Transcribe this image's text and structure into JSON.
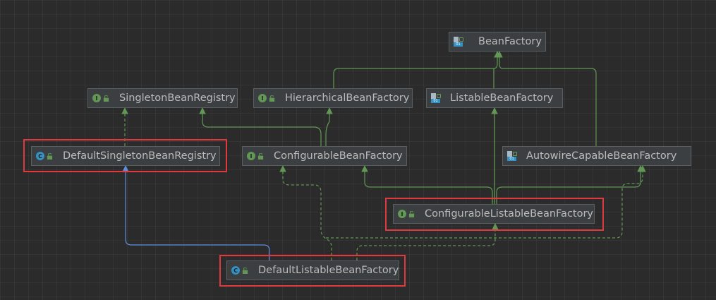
{
  "colors": {
    "background": "#2b2b2b",
    "node_fill": "#3c3f41",
    "node_border": "#5b5e60",
    "text": "#bbbbbb",
    "extends_edge": "#629755",
    "implements_edge": "#629755",
    "class_extends_edge": "#5c8ee0",
    "highlight": "#e0393e"
  },
  "nodes": {
    "bean_factory": {
      "label": "BeanFactory",
      "kind": "interface-library",
      "icon": "library-interface-icon"
    },
    "singleton_bean_registry": {
      "label": "SingletonBeanRegistry",
      "kind": "interface",
      "icon": "interface-icon"
    },
    "hierarchical_bean_factory": {
      "label": "HierarchicalBeanFactory",
      "kind": "interface",
      "icon": "interface-icon"
    },
    "listable_bean_factory": {
      "label": "ListableBeanFactory",
      "kind": "interface-library",
      "icon": "library-interface-icon"
    },
    "default_singleton_bean_registry": {
      "label": "DefaultSingletonBeanRegistry",
      "kind": "class",
      "icon": "class-icon",
      "highlighted": true
    },
    "configurable_bean_factory": {
      "label": "ConfigurableBeanFactory",
      "kind": "interface",
      "icon": "interface-icon"
    },
    "autowire_capable_bean_factory": {
      "label": "AutowireCapableBeanFactory",
      "kind": "interface-library",
      "icon": "library-interface-icon"
    },
    "configurable_listable_bean_factory": {
      "label": "ConfigurableListableBeanFactory",
      "kind": "interface",
      "icon": "interface-icon",
      "highlighted": true
    },
    "default_listable_bean_factory": {
      "label": "DefaultListableBeanFactory",
      "kind": "class",
      "icon": "class-icon",
      "highlighted": true
    }
  },
  "edges": [
    {
      "from": "hierarchical_bean_factory",
      "to": "bean_factory",
      "type": "extends"
    },
    {
      "from": "listable_bean_factory",
      "to": "bean_factory",
      "type": "extends"
    },
    {
      "from": "autowire_capable_bean_factory",
      "to": "bean_factory",
      "type": "extends"
    },
    {
      "from": "default_singleton_bean_registry",
      "to": "singleton_bean_registry",
      "type": "implements"
    },
    {
      "from": "configurable_bean_factory",
      "to": "singleton_bean_registry",
      "type": "extends"
    },
    {
      "from": "configurable_bean_factory",
      "to": "hierarchical_bean_factory",
      "type": "extends"
    },
    {
      "from": "configurable_listable_bean_factory",
      "to": "listable_bean_factory",
      "type": "extends"
    },
    {
      "from": "configurable_listable_bean_factory",
      "to": "configurable_bean_factory",
      "type": "extends"
    },
    {
      "from": "configurable_listable_bean_factory",
      "to": "autowire_capable_bean_factory",
      "type": "extends"
    },
    {
      "from": "default_listable_bean_factory",
      "to": "default_singleton_bean_registry",
      "type": "class-extends"
    },
    {
      "from": "default_listable_bean_factory",
      "to": "configurable_listable_bean_factory",
      "type": "implements"
    },
    {
      "from": "default_listable_bean_factory",
      "to": "configurable_bean_factory",
      "type": "implements"
    },
    {
      "from": "default_listable_bean_factory",
      "to": "autowire_capable_bean_factory",
      "type": "implements"
    }
  ]
}
